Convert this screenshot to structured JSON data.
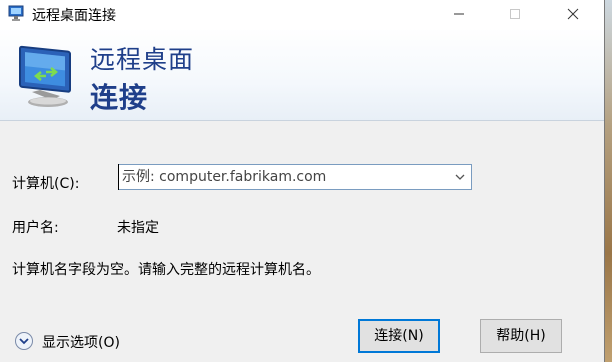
{
  "window": {
    "title": "远程桌面连接",
    "minimize_symbol": "—",
    "maximize_symbol": "☐",
    "close_symbol": "✕"
  },
  "banner": {
    "line1": "远程桌面",
    "line2": "连接",
    "icon": "remote-desktop-monitor-icon"
  },
  "form": {
    "computer_label": "计算机(C):",
    "computer_placeholder": "示例: computer.fabrikam.com",
    "computer_value": "",
    "username_label": "用户名:",
    "username_value": "未指定",
    "error_message": "计算机名字段为空。请输入完整的远程计算机名。"
  },
  "footer": {
    "options_label": "显示选项(O)",
    "connect_label": "连接(N)",
    "help_label": "帮助(H)"
  },
  "colors": {
    "accent": "#0078d7",
    "banner_text": "#1f3f8a"
  }
}
